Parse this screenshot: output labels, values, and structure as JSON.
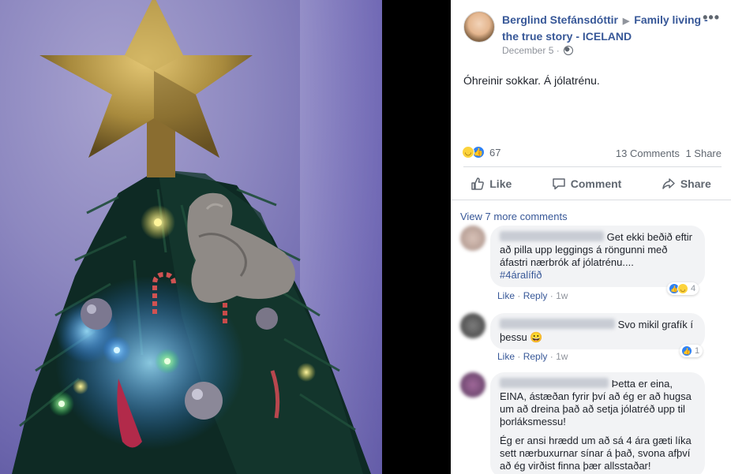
{
  "post": {
    "author": "Berglind Stefánsdóttir",
    "arrow": "▶",
    "group": "Family living - the true story - ICELAND",
    "date": "December 5",
    "date_sep": "·",
    "text": "Óhreinir sokkar. Á jólatrénu.",
    "more": "•••"
  },
  "reactions": {
    "count": "67",
    "icons": [
      "haha-icon",
      "like-icon"
    ],
    "comments": "13 Comments",
    "shares": "1 Share"
  },
  "actions": {
    "like": "Like",
    "comment": "Comment",
    "share": "Share"
  },
  "comments": {
    "view_more": "View 7 more comments",
    "items": [
      {
        "text_line1": "Get ekki beðið eftir",
        "text_rest": "að pilla upp leggings á röngunni með áfastri nærbrók af jólatrénu....",
        "hashtag": "#4áralífið",
        "like": "Like",
        "reply": "Reply",
        "time": "1w",
        "reaction_count": "4"
      },
      {
        "text_line1": "Svo mikil grafík í",
        "text_rest": "þessu 😀",
        "like": "Like",
        "reply": "Reply",
        "time": "1w",
        "reaction_count": "1"
      },
      {
        "text_line1": "Þetta er eina,",
        "text_rest": "EINA, ástæðan fyrir því að ég er að hugsa um að dreina það að setja jólatréð upp til þorláksmessu!",
        "text_p2": "Ég er ansi hrædd um að sá 4 ára gæti líka sett nærbuxurnar sínar á það, svona afþví að ég virðist finna þær allsstaðar!"
      }
    ]
  },
  "colors": {
    "link": "#385898",
    "like_blue": "#2e81f4",
    "haha_yellow": "#fcd33c"
  }
}
